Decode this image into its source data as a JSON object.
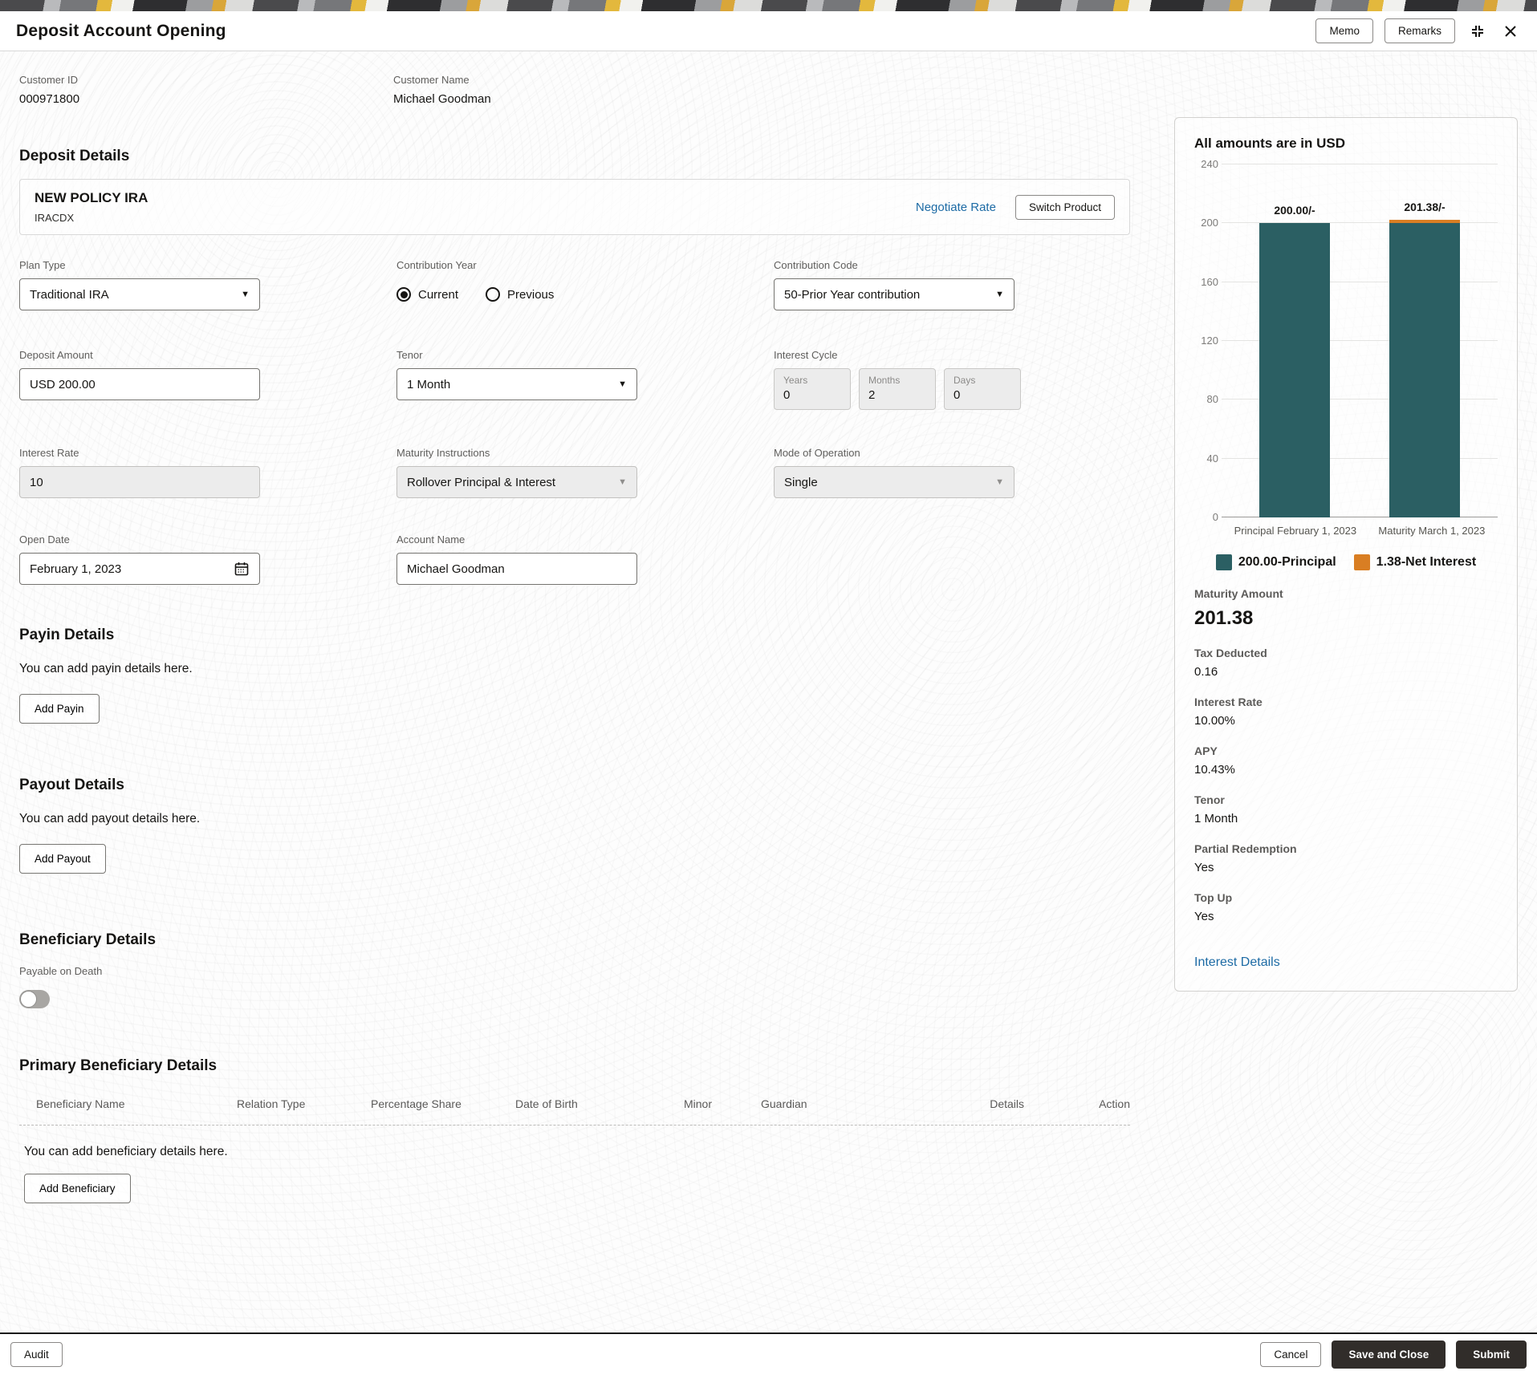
{
  "header": {
    "title": "Deposit Account Opening",
    "memo_label": "Memo",
    "remarks_label": "Remarks"
  },
  "customer": {
    "id_label": "Customer ID",
    "id_value": "000971800",
    "name_label": "Customer Name",
    "name_value": "Michael Goodman"
  },
  "deposit_details": {
    "heading": "Deposit Details",
    "product": {
      "name": "NEW POLICY IRA",
      "code": "IRACDX",
      "negotiate_rate_label": "Negotiate Rate",
      "switch_product_label": "Switch Product"
    },
    "fields": {
      "plan_type": {
        "label": "Plan Type",
        "value": "Traditional IRA"
      },
      "contribution_year": {
        "label": "Contribution Year",
        "options": [
          "Current",
          "Previous"
        ],
        "selected": "Current"
      },
      "contribution_code": {
        "label": "Contribution Code",
        "value": "50-Prior Year contribution"
      },
      "deposit_amount": {
        "label": "Deposit Amount",
        "value": "USD 200.00"
      },
      "tenor": {
        "label": "Tenor",
        "value": "1 Month"
      },
      "interest_cycle": {
        "label": "Interest Cycle",
        "years_label": "Years",
        "years_value": "0",
        "months_label": "Months",
        "months_value": "2",
        "days_label": "Days",
        "days_value": "0"
      },
      "interest_rate": {
        "label": "Interest Rate",
        "value": "10"
      },
      "maturity_instructions": {
        "label": "Maturity Instructions",
        "value": "Rollover Principal & Interest"
      },
      "mode_of_operation": {
        "label": "Mode of Operation",
        "value": "Single"
      },
      "open_date": {
        "label": "Open Date",
        "value": "February 1, 2023"
      },
      "account_name": {
        "label": "Account Name",
        "value": "Michael Goodman"
      }
    }
  },
  "payin": {
    "heading": "Payin Details",
    "empty_text": "You can add payin details here.",
    "add_label": "Add Payin"
  },
  "payout": {
    "heading": "Payout Details",
    "empty_text": "You can add payout details here.",
    "add_label": "Add Payout"
  },
  "beneficiary": {
    "heading": "Beneficiary Details",
    "payable_on_death_label": "Payable on Death",
    "payable_on_death_state": "off"
  },
  "primary_beneficiary": {
    "heading": "Primary Beneficiary Details",
    "columns": [
      "Beneficiary Name",
      "Relation Type",
      "Percentage Share",
      "Date of Birth",
      "Minor",
      "Guardian",
      "Details",
      "Action"
    ],
    "empty_text": "You can add beneficiary details here.",
    "add_label": "Add Beneficiary"
  },
  "summary_panel": {
    "title": "All amounts are in USD",
    "stats": [
      {
        "label": "Maturity Amount",
        "value": "201.38"
      },
      {
        "label": "Tax Deducted",
        "value": "0.16"
      },
      {
        "label": "Interest Rate",
        "value": "10.00%"
      },
      {
        "label": "APY",
        "value": "10.43%"
      },
      {
        "label": "Tenor",
        "value": "1 Month"
      },
      {
        "label": "Partial Redemption",
        "value": "Yes"
      },
      {
        "label": "Top Up",
        "value": "Yes"
      }
    ],
    "link_label": "Interest Details"
  },
  "chart_data": {
    "type": "bar",
    "title": "All amounts are in USD",
    "categories": [
      "Principal February 1, 2023",
      "Maturity March 1, 2023"
    ],
    "series": [
      {
        "name": "200.00-Principal",
        "color": "#2b5f63",
        "values": [
          200.0,
          200.0
        ]
      },
      {
        "name": "1.38-Net Interest",
        "color": "#d97e23",
        "values": [
          0,
          1.38
        ]
      }
    ],
    "bar_labels": [
      "200.00/-",
      "201.38/-"
    ],
    "ylim": [
      0,
      240
    ],
    "ytick_step": 40,
    "grid": true,
    "legend_position": "bottom"
  },
  "footer": {
    "audit_label": "Audit",
    "cancel_label": "Cancel",
    "save_close_label": "Save and Close",
    "submit_label": "Submit"
  },
  "colors": {
    "bar_principal": "#2b5f63",
    "bar_net_interest": "#d97e23",
    "link_blue": "#1d6ba5",
    "primary_button_bg": "#312d2a"
  },
  "icons": {
    "collapse": "corner-brackets",
    "close": "✕",
    "calendar": "calendar-glyph",
    "dropdown": "▾"
  }
}
